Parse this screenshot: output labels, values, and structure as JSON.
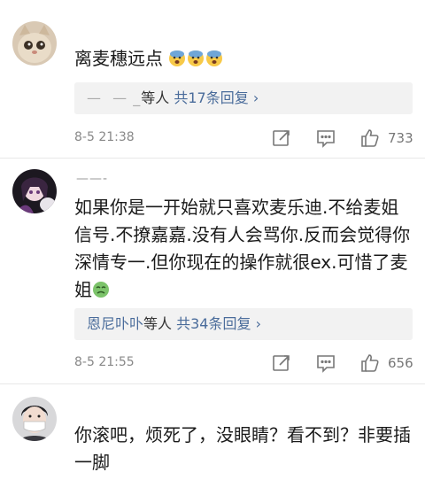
{
  "comments": [
    {
      "username": "",
      "text": "离麦穗远点",
      "emoji": [
        "fearful-face",
        "fearful-face",
        "fearful-face"
      ],
      "replies": {
        "names": "—  — _",
        "suffix": "等人",
        "count_label": "共17条回复 ›"
      },
      "time": "8-5 21:38",
      "likes": "733"
    },
    {
      "username": "——-",
      "text": "如果你是一开始就只喜欢麦乐迪.不给麦姐信号.不撩嘉嘉.没有人会骂你.反而会觉得你深情专一.但你现在的操作就很ex.可惜了麦姐",
      "emoji": [
        "nauseated-face"
      ],
      "replies": {
        "names": "恩尼卟卟",
        "suffix": "等人",
        "count_label": "共34条回复 ›"
      },
      "time": "8-5 21:55",
      "likes": "656"
    },
    {
      "username": "",
      "text": "你滚吧，烦死了，没眼睛？看不到？非要插一脚",
      "emoji": []
    }
  ],
  "colors": {
    "link": "#4a6c9b",
    "meta": "#888888",
    "reply_bg": "#f2f2f2"
  }
}
